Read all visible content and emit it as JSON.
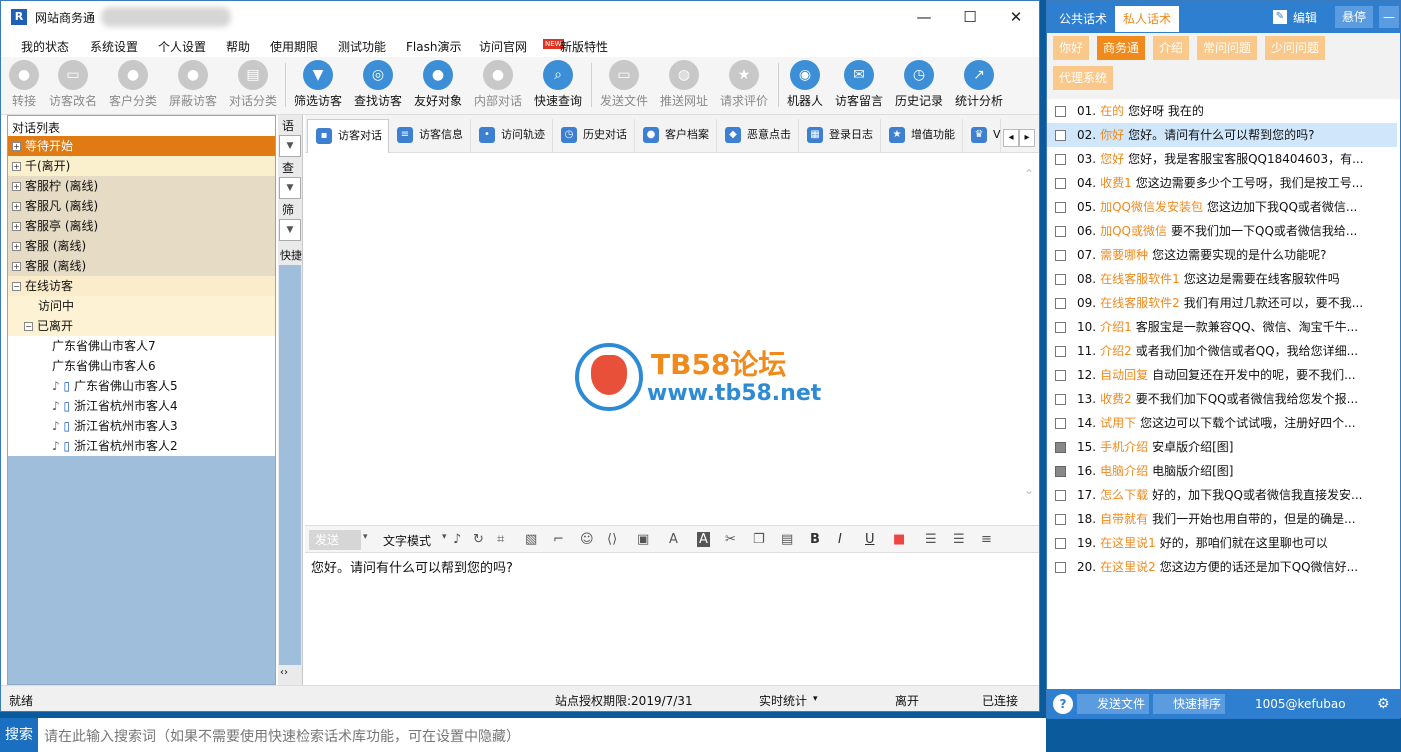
{
  "window": {
    "title": "网站商务通",
    "minimize": "—",
    "maximize": "☐",
    "close": "✕"
  },
  "menu": [
    "我的状态",
    "系统设置",
    "个人设置",
    "帮助",
    "使用期限",
    "测试功能",
    "Flash演示",
    "访问官网",
    "新版特性"
  ],
  "menu_new_badge": "NEW",
  "toolbar": [
    {
      "label": "转接",
      "icon": "person-icon",
      "enabled": false
    },
    {
      "label": "访客改名",
      "icon": "card-icon",
      "enabled": false
    },
    {
      "label": "客户分类",
      "icon": "person-icon",
      "enabled": false
    },
    {
      "label": "屏蔽访客",
      "icon": "person-icon",
      "enabled": false
    },
    {
      "label": "对话分类",
      "icon": "chat-icon",
      "enabled": false
    },
    {
      "label": "筛选访客",
      "icon": "funnel-icon",
      "enabled": true
    },
    {
      "label": "查找访客",
      "icon": "search-person-icon",
      "enabled": true
    },
    {
      "label": "友好对象",
      "icon": "group-icon",
      "enabled": true
    },
    {
      "label": "内部对话",
      "icon": "group-icon",
      "enabled": false
    },
    {
      "label": "快速查询",
      "icon": "search-icon",
      "enabled": true
    },
    {
      "label": "发送文件",
      "icon": "folder-icon",
      "enabled": false
    },
    {
      "label": "推送网址",
      "icon": "globe-icon",
      "enabled": false
    },
    {
      "label": "请求评价",
      "icon": "badge-icon",
      "enabled": false
    },
    {
      "label": "机器人",
      "icon": "robot-icon",
      "enabled": true
    },
    {
      "label": "访客留言",
      "icon": "message-icon",
      "enabled": true
    },
    {
      "label": "历史记录",
      "icon": "clock-icon",
      "enabled": true
    },
    {
      "label": "统计分析",
      "icon": "chart-icon",
      "enabled": true
    }
  ],
  "left": {
    "header": "对话列表",
    "groups": [
      {
        "label": "等待开始",
        "style": "orange",
        "toggle": "+"
      },
      {
        "label": "千(离开)",
        "style": "tan",
        "toggle": "+"
      },
      {
        "label": "客服柠 (离线)",
        "style": "tan",
        "toggle": "+"
      },
      {
        "label": "客服凡 (离线)",
        "style": "tan",
        "toggle": "+"
      },
      {
        "label": "客服亭 (离线)",
        "style": "tan",
        "toggle": "+"
      },
      {
        "label": "客服 (离线)",
        "style": "tan",
        "toggle": "+"
      },
      {
        "label": "客服 (离线)",
        "style": "tan",
        "toggle": "+"
      },
      {
        "label": "在线访客",
        "style": "cream",
        "toggle": "−"
      },
      {
        "label": "访问中",
        "style": "cream",
        "toggle": ""
      },
      {
        "label": "已离开",
        "style": "cream",
        "toggle": "−"
      }
    ],
    "visitors": [
      {
        "label": "广东省佛山市客人7",
        "device": false
      },
      {
        "label": "广东省佛山市客人6",
        "device": false
      },
      {
        "label": "广东省佛山市客人5",
        "device": true
      },
      {
        "label": "浙江省杭州市客人4",
        "device": true
      },
      {
        "label": "浙江省杭州市客人3",
        "device": true
      },
      {
        "label": "浙江省杭州市客人2",
        "device": true
      }
    ]
  },
  "mid": {
    "labels": [
      "语",
      "查",
      "筛",
      "快捷"
    ]
  },
  "tabs": [
    "访客对话",
    "访客信息",
    "访问轨迹",
    "历史对话",
    "客户档案",
    "恶意点击",
    "登录日志",
    "增值功能",
    "V"
  ],
  "watermark": {
    "cn": "TB58论坛",
    "url": "www.tb58.net"
  },
  "editor": {
    "send": "发送",
    "mode": "文字模式",
    "text": "您好。请问有什么可以帮到您的吗?"
  },
  "status": {
    "ready": "就绪",
    "license": "站点授权期限:2019/7/31",
    "stats": "实时统计",
    "away": "离开",
    "connected": "已连接"
  },
  "search": {
    "label": "搜索",
    "placeholder": "请在此输入搜索词（如果不需要使用快速检索话术库功能，可在设置中隐藏）"
  },
  "right": {
    "tabs": [
      "公共话术",
      "私人话术"
    ],
    "edit": "编辑",
    "pin": "悬停",
    "minimize": "—",
    "categories": [
      "你好",
      "商务通",
      "介绍",
      "常问问题",
      "少问问题",
      "代理系统"
    ],
    "items": [
      {
        "num": "01.",
        "kw": "在的",
        "text": "您好呀  我在的"
      },
      {
        "num": "02.",
        "kw": "你好",
        "text": "您好。请问有什么可以帮到您的吗?"
      },
      {
        "num": "03.",
        "kw": "您好",
        "text": "您好，我是客服宝客服QQ18404603，有..."
      },
      {
        "num": "04.",
        "kw": "收费1",
        "text": "您这边需要多少个工号呀，我们是按工号..."
      },
      {
        "num": "05.",
        "kw": "加QQ微信发安装包",
        "text": "您这边加下我QQ或者微信..."
      },
      {
        "num": "06.",
        "kw": "加QQ或微信",
        "text": "要不我们加一下QQ或者微信我给..."
      },
      {
        "num": "07.",
        "kw": "需要哪种",
        "text": "您这边需要实现的是什么功能呢?"
      },
      {
        "num": "08.",
        "kw": "在线客服软件1",
        "text": "您这边是需要在线客服软件吗"
      },
      {
        "num": "09.",
        "kw": "在线客服软件2",
        "text": "我们有用过几款还可以，要不我..."
      },
      {
        "num": "10.",
        "kw": "介绍1",
        "text": "客服宝是一款兼容QQ、微信、淘宝千牛..."
      },
      {
        "num": "11.",
        "kw": "介绍2",
        "text": "或者我们加个微信或者QQ，我给您详细..."
      },
      {
        "num": "12.",
        "kw": "自动回复",
        "text": "自动回复还在开发中的呢，要不我们..."
      },
      {
        "num": "13.",
        "kw": "收费2",
        "text": "要不我们加下QQ或者微信我给您发个报..."
      },
      {
        "num": "14.",
        "kw": "试用下",
        "text": "您这边可以下载个试试哦，注册好四个..."
      },
      {
        "num": "15.",
        "kw": "手机介绍",
        "text": "安卓版介绍[图]",
        "img": true
      },
      {
        "num": "16.",
        "kw": "电脑介绍",
        "text": "电脑版介绍[图]",
        "img": true
      },
      {
        "num": "17.",
        "kw": "怎么下载",
        "text": "好的，加下我QQ或者微信我直接发安..."
      },
      {
        "num": "18.",
        "kw": "自带就有",
        "text": "我们一开始也用自带的，但是的确是..."
      },
      {
        "num": "19.",
        "kw": "在这里说1",
        "text": "好的，那咱们就在这里聊也可以"
      },
      {
        "num": "20.",
        "kw": "在这里说2",
        "text": "您这边方便的话还是加下QQ微信好..."
      }
    ],
    "selected_index": 1,
    "bottom": {
      "send_file": "发送文件",
      "sort": "快速排序",
      "account": "1005@kefubao"
    }
  },
  "colors": {
    "accent_orange": "#f08a1d",
    "brand_blue": "#2f7fd0",
    "waiting_group": "#e07a12"
  }
}
